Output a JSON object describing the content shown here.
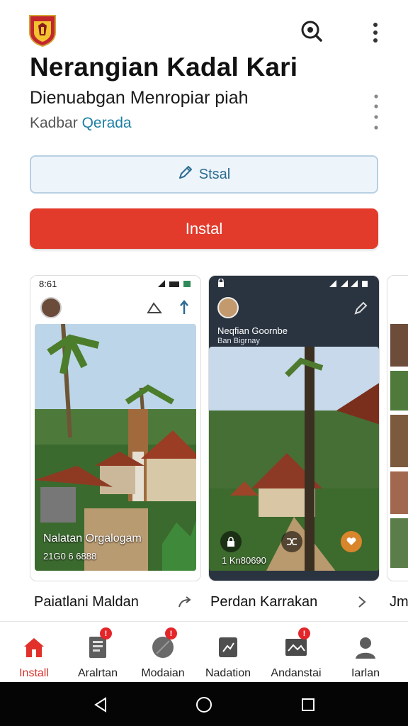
{
  "app": {
    "title": "Nerangian Kadal Kari",
    "subtitle": "Dienuabgan Menropiar piah",
    "meta_label": "Kadbar",
    "meta_link": "Qerada"
  },
  "actions": {
    "secondary_label": "Stsal",
    "install_label": "Instal"
  },
  "screenshots": [
    {
      "status_time": "8:61",
      "overlay_title": "Nalatan Orgalogam",
      "overlay_sub": "21G0 6 6888"
    },
    {
      "header_title": "Neqfian Goornbe",
      "header_sub": "Ban Bigrnay",
      "overlay_sub": "1 Kn80690"
    }
  ],
  "captions": [
    {
      "label": "Paiatlani Maldan"
    },
    {
      "label": "Perdan Karrakan"
    },
    {
      "label": "Jm"
    }
  ],
  "nav": {
    "items": [
      {
        "label": "Install",
        "icon": "home-icon",
        "active": true,
        "badge": false
      },
      {
        "label": "Aralrtan",
        "icon": "document-icon",
        "badge": true
      },
      {
        "label": "Modaian",
        "icon": "leaf-icon",
        "badge": true
      },
      {
        "label": "Nadation",
        "icon": "clipboard-icon",
        "badge": false
      },
      {
        "label": "Andanstai",
        "icon": "image-icon",
        "badge": true
      },
      {
        "label": "Iarlan",
        "icon": "person-icon",
        "badge": false
      }
    ],
    "badge_text": "!"
  },
  "colors": {
    "accent": "#e23a2b",
    "link": "#1d7fa6",
    "secondary_border": "#b8d0e4"
  }
}
